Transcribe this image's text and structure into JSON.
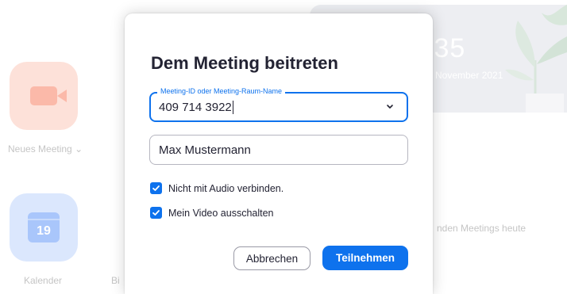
{
  "background": {
    "new_meeting_label": "Neues Meeting",
    "new_meeting_chevron": "⌄",
    "calendar_label": "Kalender",
    "calendar_day": "19",
    "partial_label": "Bi",
    "clock_time": ":35",
    "clock_date": "November 2021",
    "no_meetings_text": "nden Meetings heute",
    "icons": {
      "new_meeting": "video-camera-icon",
      "calendar": "calendar-icon"
    },
    "colors": {
      "new_meeting_tile": "#fde1d9",
      "calendar_tile": "#dbe7fd"
    }
  },
  "dialog": {
    "title": "Dem Meeting beitreten",
    "meeting_id": {
      "legend": "Meeting-ID oder Meeting-Raum-Name",
      "value": "409 714 3922",
      "dropdown_icon": "chevron-down-icon"
    },
    "name": {
      "value": "Max Mustermann"
    },
    "checkboxes": [
      {
        "label": "Nicht mit Audio verbinden.",
        "checked": true
      },
      {
        "label": "Mein Video ausschalten",
        "checked": true
      }
    ],
    "buttons": {
      "cancel": "Abbrechen",
      "join": "Teilnehmen"
    },
    "colors": {
      "accent": "#0e72ed",
      "text": "#232333"
    }
  }
}
